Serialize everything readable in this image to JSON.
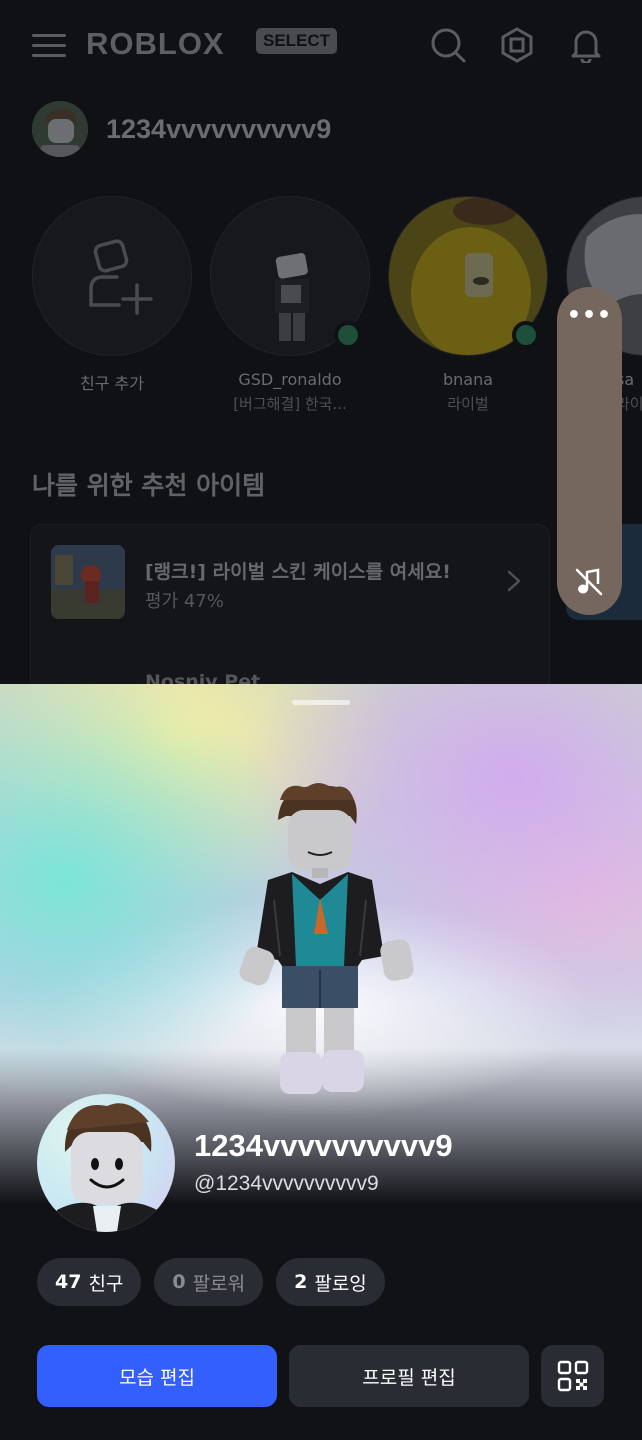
{
  "header": {
    "logo_text": "ROBLOX",
    "badge_text": "SELECT",
    "icons": [
      "menu-icon",
      "search-icon",
      "robux-icon",
      "bell-icon"
    ]
  },
  "user": {
    "username": "1234vvvvvvvvvv9"
  },
  "friends_row": [
    {
      "name": "친구 추가",
      "status": "",
      "icon": "add-friend-icon"
    },
    {
      "name": "GSD_ronaldo",
      "status": "[버그해결] 한국...",
      "online": true
    },
    {
      "name": "bnana",
      "status": "라이벌",
      "online": true
    },
    {
      "name": "sa",
      "status": "라이",
      "online": false
    }
  ],
  "recommended": {
    "title": "나를 위한 추천 아이템",
    "items": [
      {
        "title": "[랭크!] 라이벌 스킨 케이스를 여세요!",
        "subtitle": "평가 47%"
      },
      {
        "title": "Nosniy Pet",
        "subtitle": ""
      }
    ]
  },
  "voice_panel": {
    "more_label": "•••",
    "icons": [
      "more-icon",
      "music-muted-icon"
    ]
  },
  "profile": {
    "display_name": "1234vvvvvvvvvv9",
    "handle": "@1234vvvvvvvvvv9",
    "stats": [
      {
        "count": "47",
        "label": "친구"
      },
      {
        "count": "0",
        "label": "팔로워"
      },
      {
        "count": "2",
        "label": "팔로잉"
      }
    ],
    "buttons": {
      "edit_avatar": "모습 편집",
      "edit_profile": "프로필 편집",
      "qr_icon": "qr-code-icon"
    }
  },
  "colors": {
    "primary_button": "#335fff",
    "online": "#1d4f3a",
    "voice_pill": "#75675d"
  }
}
